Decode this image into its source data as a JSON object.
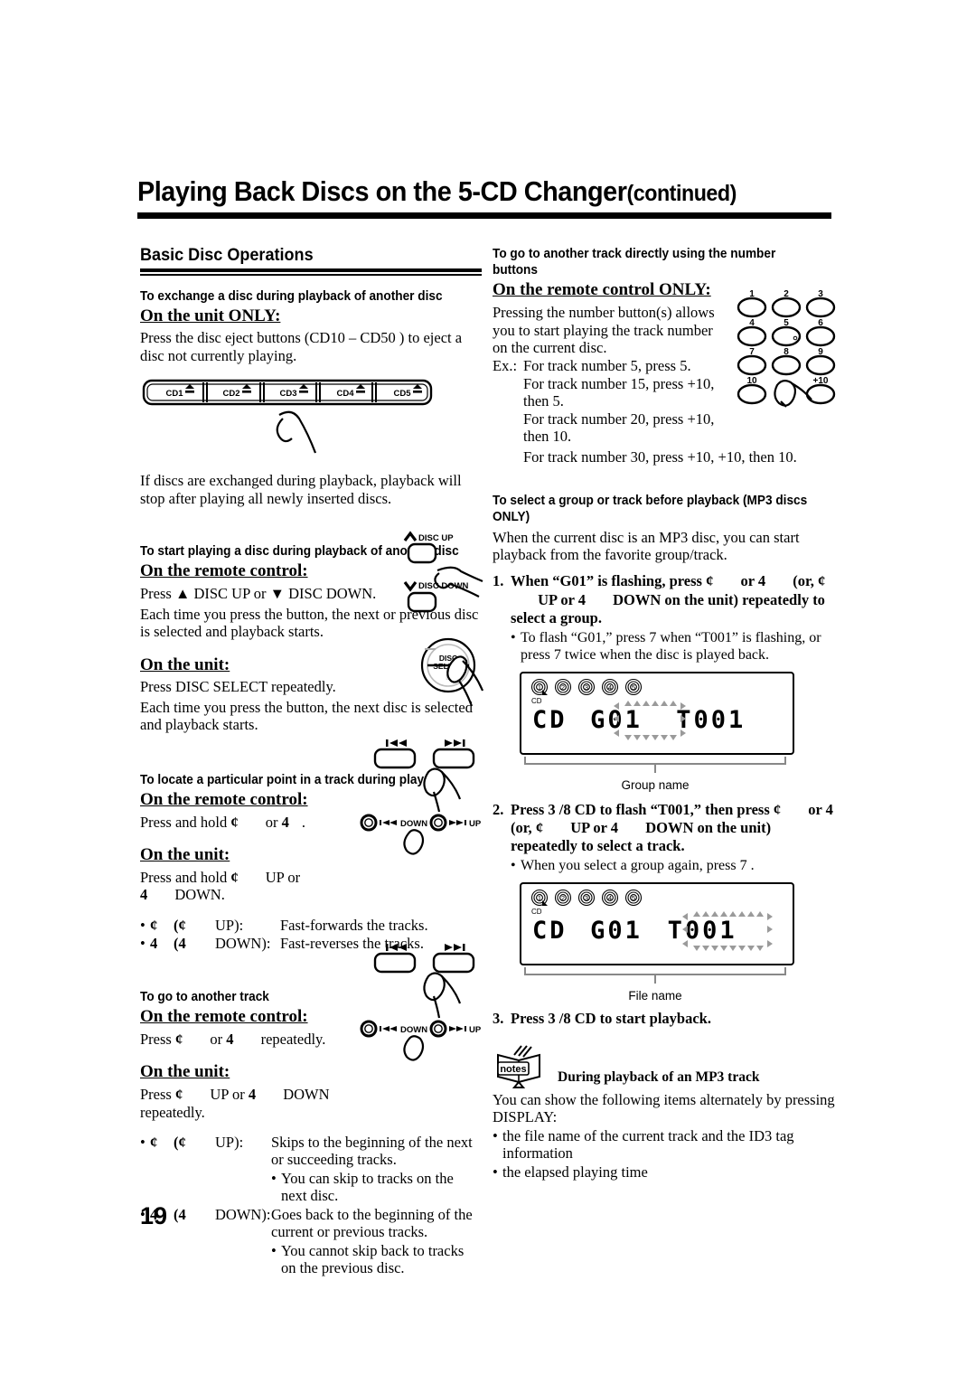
{
  "header": {
    "title": "Playing Back Discs on the 5-CD Changer",
    "title_suffix": "(continued)"
  },
  "page_number": "19",
  "left_column": {
    "section_title": "Basic Disc Operations",
    "s1": {
      "heading": "To exchange a disc during playback of another disc",
      "mode": "On the unit ONLY:",
      "body1": "Press the disc eject buttons (CD10  – CD50 ) to eject a disc not currently playing.",
      "body2": "If discs are exchanged during playback, playback will stop after playing all newly inserted discs.",
      "eject_buttons": [
        "CD1",
        "CD2",
        "CD3",
        "CD4",
        "CD5"
      ]
    },
    "s2": {
      "heading": "To start playing a disc during playback of another disc",
      "mode1": "On the remote control:",
      "body1": "Press",
      "body1b": "DISC UP or",
      "body1c": "DISC DOWN.",
      "body2": "Each time you press the button, the next or previous disc is selected and playback starts.",
      "mode2": "On the unit:",
      "body3": "Press DISC SELECT repeatedly.",
      "body4": "Each time you press the button, the next disc is selected and playback starts.",
      "ill_disc_up": "DISC UP",
      "ill_disc_down": "DISC DOWN",
      "ill_disc_select": "DISC SELECT"
    },
    "s3": {
      "heading": "To locate a particular point in a track during play",
      "mode1": "On the remote control:",
      "body1_a": "Press and hold",
      "body1_b": "or",
      "body1_c": ".",
      "mode2": "On the unit:",
      "body2_a": "Press and hold",
      "body2_b": "UP or",
      "body2_c": "DOWN.",
      "bullets": [
        {
          "sym": "¢",
          "paren": "(¢",
          "dir": "UP):",
          "text": "Fast-forwards the tracks."
        },
        {
          "sym": "4",
          "paren": "(4",
          "dir": "DOWN):",
          "text": "Fast-reverses the tracks."
        }
      ],
      "ill_down": "DOWN",
      "ill_up": "UP"
    },
    "s4": {
      "heading": "To go to another track",
      "mode1": "On the remote control:",
      "body1_a": "Press",
      "body1_b": "or",
      "body1_c": "repeatedly.",
      "mode2": "On the unit:",
      "body2_a": "Press",
      "body2_b": "UP or",
      "body2_c": "DOWN",
      "body2_d": "repeatedly.",
      "bullets": [
        {
          "sym": "¢",
          "paren": "(¢",
          "dir": "UP):",
          "text": "Skips to the beginning of the next or succeeding tracks.",
          "sub": "You can skip to tracks on the next disc."
        },
        {
          "sym": "4",
          "paren": "(4",
          "dir": "DOWN):",
          "text": "Goes back to the beginning of the current or previous tracks.",
          "sub": "You cannot skip back to tracks on the previous disc."
        }
      ],
      "ill_down": "DOWN",
      "ill_up": "UP"
    }
  },
  "right_column": {
    "s1": {
      "heading": "To go to another track directly using the number buttons",
      "mode": "On the remote control ONLY:",
      "body1": "Pressing the number button(s) allows you to start playing the track number on the current disc.",
      "ex_label": "Ex.:",
      "examples": [
        "For track number 5, press 5.",
        "For track number 15, press +10, then 5.",
        "For track number 20, press +10, then 10.",
        "For track number 30, press +10, +10, then 10."
      ],
      "keypad": [
        "1",
        "2",
        "3",
        "4",
        "5",
        "6",
        "7",
        "8",
        "9",
        "10",
        "",
        "+10"
      ]
    },
    "s2": {
      "heading": "To select a group or track before playback (MP3 discs ONLY)",
      "body1": "When the current disc is an MP3 disc, you can start playback from the favorite group/track.",
      "step1": {
        "num": "1.",
        "text_a": "When “G01” is flashing, press",
        "text_b": "or 4",
        "text_c": "(or,",
        "text_d": "UP",
        "text_e": "or 4",
        "text_f": "DOWN on the unit) repeatedly to select a group.",
        "sub": "To flash “G01,” press 7  when “T001” is flashing, or press 7  twice when the disc is played back."
      },
      "display1": {
        "disc_indicators": [
          "1",
          "2",
          "3",
          "4",
          "5"
        ],
        "cd_label": "CD",
        "text_cd": "CD",
        "text_group": "G01",
        "text_track": "T001",
        "flashing": "group",
        "caption": "Group name"
      },
      "step2": {
        "num": "2.",
        "text_a": "Press 3 /8 CD to flash “T001,” then press",
        "text_b": "or 4",
        "text_c": "(or,",
        "text_d": "UP or 4",
        "text_e": "DOWN on the unit) repeatedly to select a track.",
        "sub": "When you select a group again, press 7 ."
      },
      "display2": {
        "disc_indicators": [
          "1",
          "2",
          "3",
          "4",
          "5"
        ],
        "cd_label": "CD",
        "text_cd": "CD",
        "text_group": "G01",
        "text_track": "T001",
        "flashing": "track",
        "caption": "File name"
      },
      "step3": {
        "num": "3.",
        "text": "Press 3 /8 CD to start playback."
      }
    },
    "notes": {
      "icon_label": "notes",
      "title": "During playback of an MP3 track",
      "body": "You can show the following items alternately by pressing DISPLAY:",
      "bullets": [
        "the file name of the current track and the ID3 tag information",
        "the elapsed playing time"
      ]
    }
  },
  "colors": {
    "ink": "#000000",
    "paper": "#ffffff"
  }
}
